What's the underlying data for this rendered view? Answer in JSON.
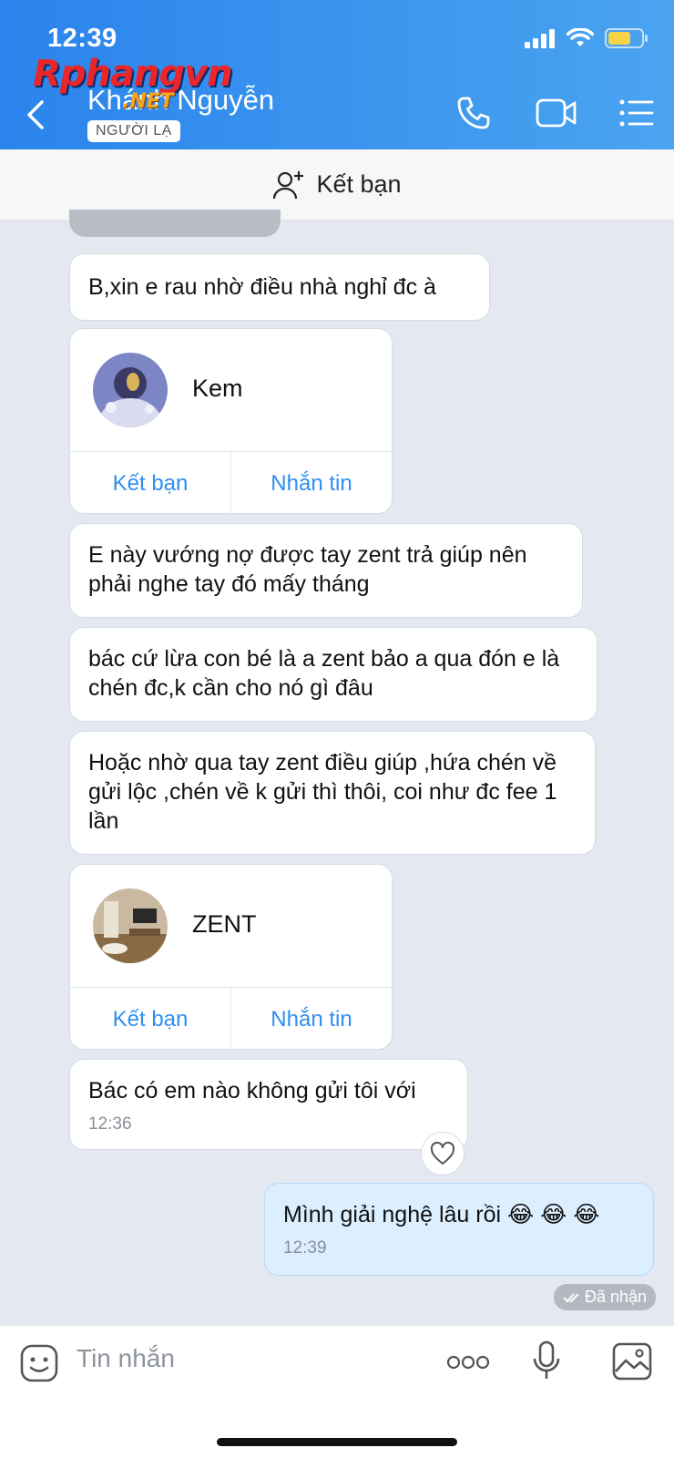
{
  "status": {
    "time": "12:39"
  },
  "watermark": {
    "main": "Rphangvn",
    "suffix": ".NET"
  },
  "header": {
    "contact_name": "Khánh Nguyễn",
    "badge": "NGƯỜI LẠ"
  },
  "friend_bar": {
    "label": "Kết bạn"
  },
  "messages": [
    {
      "text": "B,xin e rau nhờ điều nhà nghỉ đc à"
    },
    {
      "text": "E này vướng nợ được tay zent trả giúp nên phải nghe tay đó mấy tháng"
    },
    {
      "text": "bác cứ lừa con bé là a zent bảo a qua đón e là chén đc,k cần cho nó gì đâu"
    },
    {
      "text": "Hoặc nhờ qua tay zent điều giúp ,hứa chén về gửi lộc ,chén về k gửi thì thôi, coi như đc fee 1 lần"
    },
    {
      "text": "Bác có em nào không gửi tôi với",
      "time": "12:36"
    },
    {
      "text": "Mình giải nghệ lâu rồi 😂 😂 😂",
      "time": "12:39"
    }
  ],
  "cards": [
    {
      "name": "Kem",
      "add_friend": "Kết bạn",
      "message": "Nhắn tin"
    },
    {
      "name": "ZENT",
      "add_friend": "Kết bạn",
      "message": "Nhắn tin"
    }
  ],
  "receipt": {
    "label": "Đã nhận"
  },
  "input": {
    "placeholder": "Tin nhắn"
  },
  "colors": {
    "header_start": "#2a84ec",
    "header_end": "#4aa4f0",
    "link": "#2f8ef0",
    "own_bubble": "#dcefff",
    "chat_bg": "#e4e8f1"
  }
}
